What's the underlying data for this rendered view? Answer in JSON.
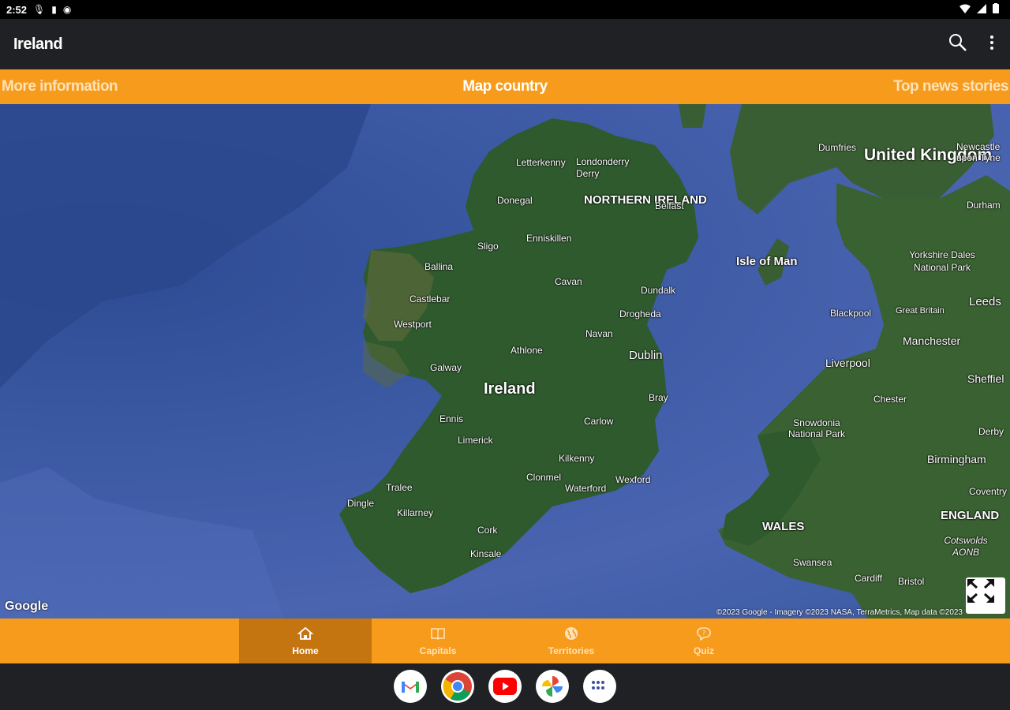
{
  "status": {
    "time": "2:52"
  },
  "appbar": {
    "title": "Ireland",
    "search_icon": "search-icon",
    "menu_icon": "more-vert-icon"
  },
  "tabs": {
    "left": "More information",
    "center": "Map country",
    "right": "Top news stories"
  },
  "map": {
    "labels": {
      "ireland": "Ireland",
      "northern_ireland": "NORTHERN IRELAND",
      "united_kingdom": "United Kingdom",
      "isle_of_man": "Isle of Man",
      "wales": "WALES",
      "england": "ENGLAND",
      "letterkenny": "Letterkenny",
      "londonderry": "Londonderry",
      "derry": "Derry",
      "donegal": "Donegal",
      "belfast": "Belfast",
      "enniskillen": "Enniskillen",
      "sligo": "Sligo",
      "ballina": "Ballina",
      "cavan": "Cavan",
      "dundalk": "Dundalk",
      "castlebar": "Castlebar",
      "westport": "Westport",
      "drogheda": "Drogheda",
      "navan": "Navan",
      "athlone": "Athlone",
      "dublin": "Dublin",
      "galway": "Galway",
      "bray": "Bray",
      "ennis": "Ennis",
      "carlow": "Carlow",
      "limerick": "Limerick",
      "kilkenny": "Kilkenny",
      "tralee": "Tralee",
      "clonmel": "Clonmel",
      "wexford": "Wexford",
      "waterford": "Waterford",
      "dingle": "Dingle",
      "killarney": "Killarney",
      "cork": "Cork",
      "kinsale": "Kinsale",
      "dumfries": "Dumfries",
      "newcastle": "Newcastle upon Tyne",
      "durham": "Durham",
      "yorkshire_dales": "Yorkshire Dales National Park",
      "leeds": "Leeds",
      "blackpool": "Blackpool",
      "great_britain": "Great Britain",
      "manchester": "Manchester",
      "liverpool": "Liverpool",
      "sheffield": "Sheffiel",
      "chester": "Chester",
      "snowdonia": "Snowdonia National Park",
      "derby": "Derby",
      "birmingham": "Birmingham",
      "coventry": "Coventry",
      "cotswolds": "Cotswolds AONB",
      "swansea": "Swansea",
      "cardiff": "Cardiff",
      "bristol": "Bristol"
    },
    "google": "Google",
    "attribution": "©2023 Google - Imagery ©2023 NASA, TerraMetrics, Map data ©2023"
  },
  "bottom_nav": [
    {
      "label": "Home",
      "icon": "home-icon",
      "active": true
    },
    {
      "label": "Capitals",
      "icon": "book-icon",
      "active": false
    },
    {
      "label": "Territories",
      "icon": "globe-icon",
      "active": false
    },
    {
      "label": "Quiz",
      "icon": "quiz-bubble-icon",
      "active": false
    }
  ],
  "dock": [
    "gmail-icon",
    "chrome-icon",
    "youtube-icon",
    "photos-icon",
    "apps-icon"
  ],
  "colors": {
    "accent": "#F79B1C",
    "accent_active": "#C47510",
    "appbar": "#202124"
  }
}
